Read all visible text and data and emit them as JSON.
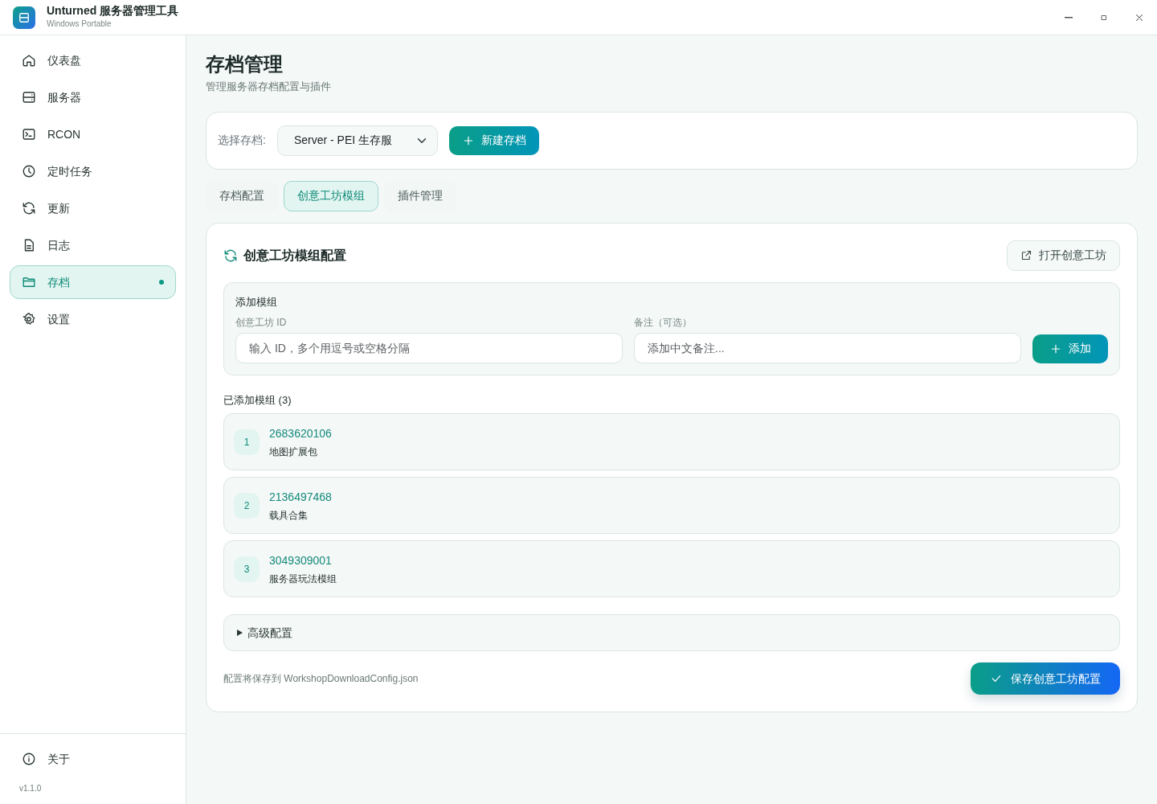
{
  "window": {
    "title": "Unturned 服务器管理工具",
    "subtitle": "Windows Portable"
  },
  "sidebar": {
    "items": [
      {
        "label": "仪表盘",
        "selected": false
      },
      {
        "label": "服务器",
        "selected": false
      },
      {
        "label": "RCON",
        "selected": false
      },
      {
        "label": "定时任务",
        "selected": false
      },
      {
        "label": "更新",
        "selected": false
      },
      {
        "label": "日志",
        "selected": false
      },
      {
        "label": "存档",
        "selected": true
      },
      {
        "label": "设置",
        "selected": false
      }
    ],
    "footer": {
      "label": "关于",
      "version": "v1.1.0"
    }
  },
  "page": {
    "title": "存档管理",
    "subtitle": "管理服务器存档配置与插件"
  },
  "save_picker": {
    "label": "选择存档:",
    "value": "Server - PEI 生存服",
    "new_button": "新建存档"
  },
  "tabs": [
    {
      "label": "存档配置",
      "selected": false
    },
    {
      "label": "创意工坊模组",
      "selected": true
    },
    {
      "label": "插件管理",
      "selected": false
    }
  ],
  "panel": {
    "title": "创意工坊模组配置",
    "open_button": "打开创意工坊",
    "add_form": {
      "title": "添加模组",
      "id_label": "创意工坊 ID",
      "id_placeholder": "输入 ID，多个用逗号或空格分隔",
      "note_label": "备注（可选）",
      "note_placeholder": "添加中文备注...",
      "add_button": "添加"
    },
    "list_title": "已添加模组 (3)",
    "mods": [
      {
        "index": "1",
        "id": "2683620106",
        "note": "地图扩展包"
      },
      {
        "index": "2",
        "id": "2136497468",
        "note": "载具合集"
      },
      {
        "index": "3",
        "id": "3049309001",
        "note": "服务器玩法模组"
      }
    ],
    "advanced": {
      "label": "高级配置",
      "expanded": false
    },
    "footer_note": "配置将保存到 WorkshopDownloadConfig.json",
    "save_button": "保存创意工坊配置"
  }
}
